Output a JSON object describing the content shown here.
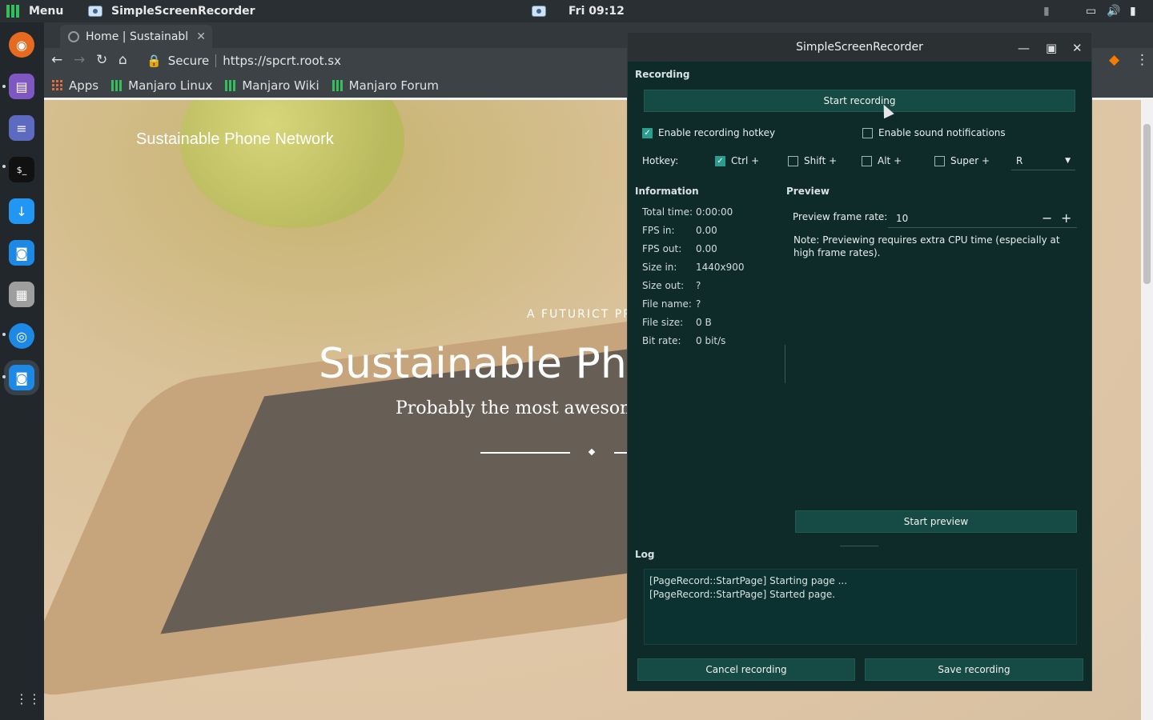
{
  "topbar": {
    "menu_label": "Menu",
    "active_app": "SimpleScreenRecorder",
    "clock": "Fri 09:12"
  },
  "dock": {
    "items": [
      "firefox-icon",
      "files-icon",
      "text-editor-icon",
      "terminal-icon",
      "download-icon",
      "screen-recorder-icon",
      "calculator-icon",
      "chrome-icon",
      "screen-recorder-active-icon"
    ],
    "apps_grid_label": ""
  },
  "browser": {
    "tab_title": "Home | Sustainabl",
    "secure_label": "Secure",
    "url": "https://spcrt.root.sx",
    "bookmarks": [
      "Apps",
      "Manjaro Linux",
      "Manjaro Wiki",
      "Manjaro Forum"
    ]
  },
  "page": {
    "site_name": "Sustainable Phone Network",
    "kicker": "A FUTURICT PRO",
    "title": "Sustainable Pho",
    "subtitle": "Probably the most awesome"
  },
  "ssr": {
    "window_title": "SimpleScreenRecorder",
    "recording_section": "Recording",
    "start_recording": "Start recording",
    "enable_hotkey": "Enable recording hotkey",
    "enable_sound": "Enable sound notifications",
    "hotkey_label": "Hotkey:",
    "hotkeys": {
      "ctrl": "Ctrl +",
      "shift": "Shift +",
      "alt": "Alt +",
      "super": "Super +",
      "key": "R"
    },
    "information_section": "Information",
    "info": [
      {
        "k": "Total time:",
        "v": "0:00:00"
      },
      {
        "k": "FPS in:",
        "v": "0.00"
      },
      {
        "k": "FPS out:",
        "v": "0.00"
      },
      {
        "k": "Size in:",
        "v": "1440x900"
      },
      {
        "k": "Size out:",
        "v": "?"
      },
      {
        "k": "File name:",
        "v": "?"
      },
      {
        "k": "File size:",
        "v": "0 B"
      },
      {
        "k": "Bit rate:",
        "v": "0 bit/s"
      }
    ],
    "preview_section": "Preview",
    "preview_rate_label": "Preview frame rate:",
    "preview_rate_value": "10",
    "preview_note": "Note: Previewing requires extra CPU time (especially at high frame rates).",
    "start_preview": "Start preview",
    "log_section": "Log",
    "log_lines": [
      "[PageRecord::StartPage] Starting page ...",
      "[PageRecord::StartPage] Started page."
    ],
    "cancel_recording": "Cancel recording",
    "save_recording": "Save recording"
  }
}
